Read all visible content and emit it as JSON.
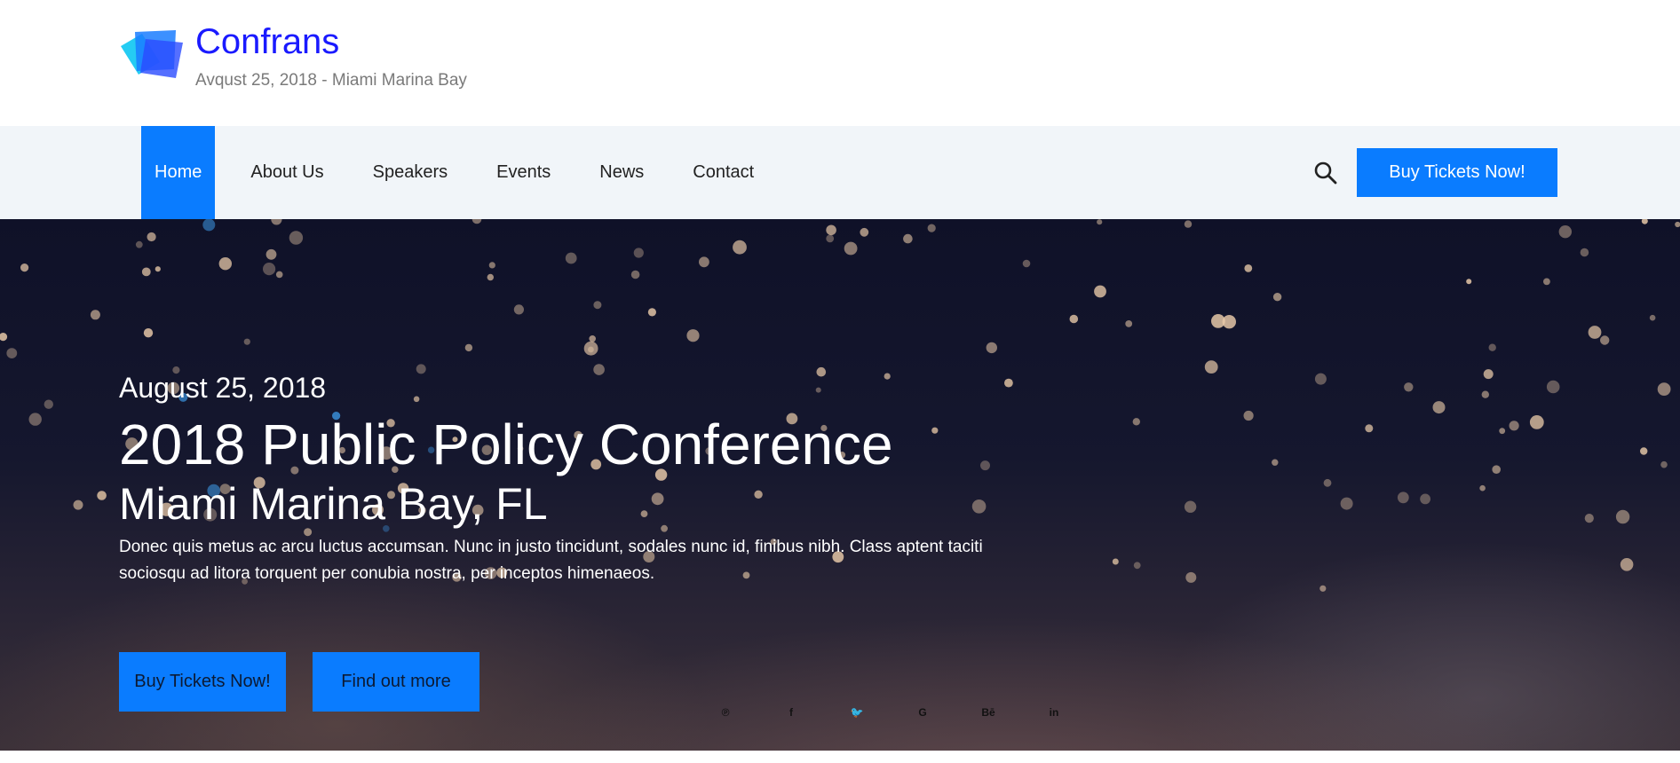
{
  "header": {
    "brand_name": "Confrans",
    "brand_sub": "Avqust 25, 2018 - Miami Marina Bay",
    "logo_icon": "layered-squares-logo"
  },
  "nav": {
    "items": [
      {
        "label": "Home",
        "active": true
      },
      {
        "label": "About Us",
        "active": false
      },
      {
        "label": "Speakers",
        "active": false
      },
      {
        "label": "Events",
        "active": false
      },
      {
        "label": "News",
        "active": false
      },
      {
        "label": "Contact",
        "active": false
      }
    ],
    "search_icon": "search-icon",
    "cta_label": "Buy Tickets Now!"
  },
  "hero": {
    "date": "August 25, 2018",
    "title": "2018 Public Policy Conference",
    "location": "Miami Marina Bay, FL",
    "description": "Donec quis metus ac arcu luctus accumsan. Nunc in justo tincidunt, sodales nunc id, finibus nibh. Class aptent taciti sociosqu ad litora torquent per conubia nostra, per inceptos himenaeos.",
    "buttons": {
      "tickets": "Buy Tickets Now!",
      "more": "Find out more"
    },
    "socials": [
      {
        "icon": "pinterest-icon",
        "glyph": "℗"
      },
      {
        "icon": "facebook-icon",
        "glyph": "f"
      },
      {
        "icon": "twitter-icon",
        "glyph": "🐦"
      },
      {
        "icon": "google-plus-icon",
        "glyph": "G"
      },
      {
        "icon": "behance-icon",
        "glyph": "Bē"
      },
      {
        "icon": "linkedin-icon",
        "glyph": "in"
      }
    ]
  },
  "colors": {
    "accent": "#0a7cff",
    "brand_text": "#1a1aff",
    "nav_bg": "#f1f5f9"
  }
}
